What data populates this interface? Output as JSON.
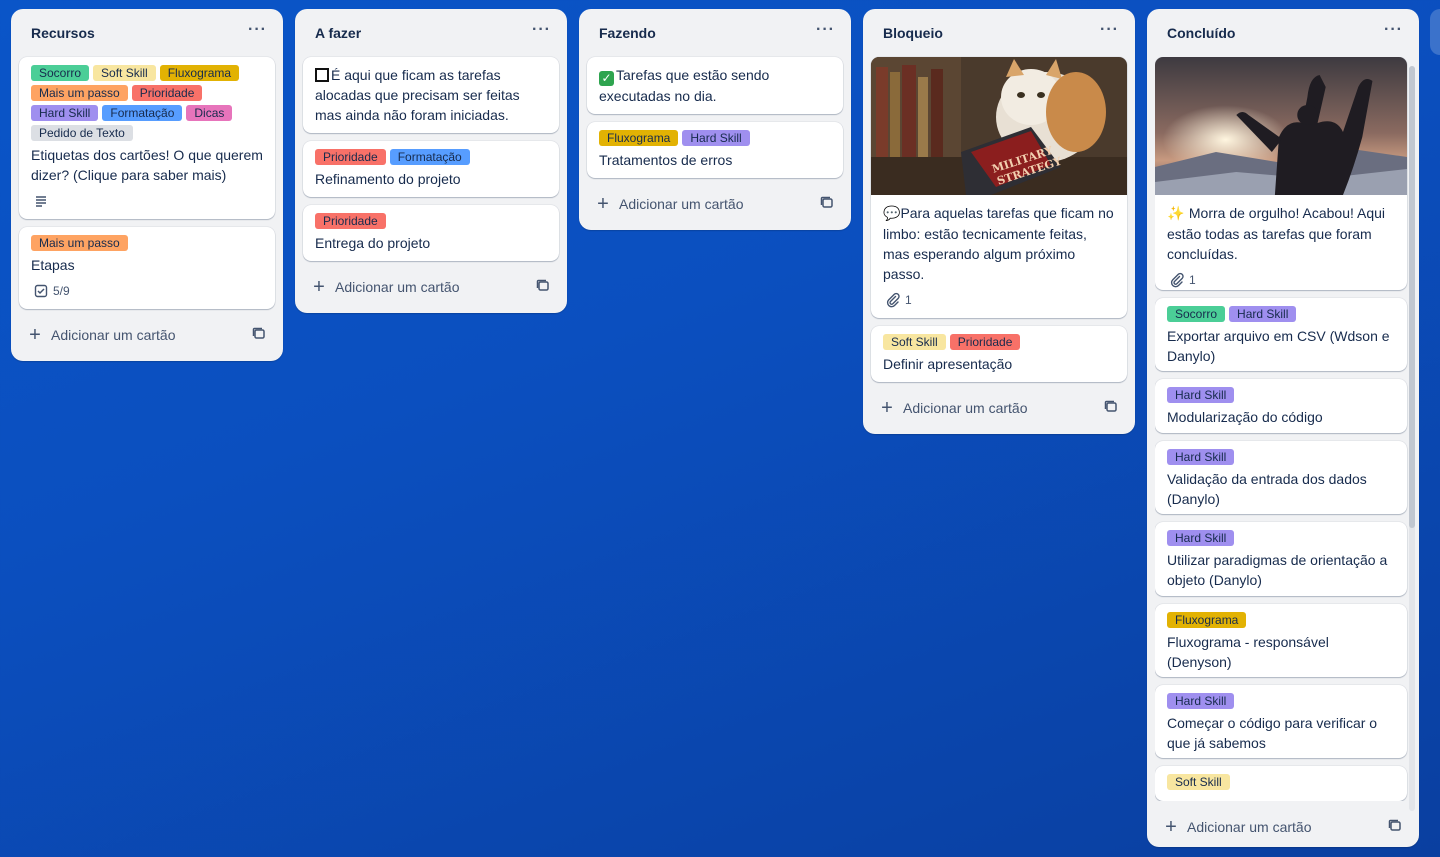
{
  "colors": {
    "green": "#4bce97",
    "yellow_light": "#f8e6a0",
    "yellow": "#e2b203",
    "orange": "#fea362",
    "red": "#f87168",
    "purple": "#9f8fef",
    "blue": "#579dff",
    "pink": "#e774bb",
    "gray": "#dcdfe4"
  },
  "add_card_label": "Adicionar um cartão",
  "lists": [
    {
      "title": "Recursos",
      "cards": [
        {
          "labels": [
            {
              "text": "Socorro",
              "color": "green"
            },
            {
              "text": "Soft Skill",
              "color": "yellow_light"
            },
            {
              "text": "Fluxograma",
              "color": "yellow"
            },
            {
              "text": "Mais um passo",
              "color": "orange"
            },
            {
              "text": "Prioridade",
              "color": "red"
            },
            {
              "text": "Hard Skill",
              "color": "purple"
            },
            {
              "text": "Formatação",
              "color": "blue"
            },
            {
              "text": "Dicas",
              "color": "pink"
            },
            {
              "text": "Pedido de Texto",
              "color": "gray"
            }
          ],
          "title": "Etiquetas dos cartões! O que querem dizer? (Clique para saber mais)",
          "badges": [
            {
              "icon": "description-icon",
              "text": ""
            }
          ]
        },
        {
          "labels": [
            {
              "text": "Mais um passo",
              "color": "orange"
            }
          ],
          "title": "Etapas",
          "badges": [
            {
              "icon": "checklist-icon",
              "text": "5/9"
            }
          ]
        }
      ]
    },
    {
      "title": "A fazer",
      "cards": [
        {
          "prefix": "square",
          "title": "É aqui que ficam as tarefas alocadas que precisam ser feitas mas ainda não foram iniciadas."
        },
        {
          "labels": [
            {
              "text": "Prioridade",
              "color": "red"
            },
            {
              "text": "Formatação",
              "color": "blue"
            }
          ],
          "title": "Refinamento do projeto"
        },
        {
          "labels": [
            {
              "text": "Prioridade",
              "color": "red"
            }
          ],
          "title": "Entrega do projeto"
        }
      ]
    },
    {
      "title": "Fazendo",
      "cards": [
        {
          "prefix": "check",
          "title": "Tarefas que estão sendo executadas no dia."
        },
        {
          "labels": [
            {
              "text": "Fluxograma",
              "color": "yellow"
            },
            {
              "text": "Hard Skill",
              "color": "purple"
            }
          ],
          "title": "Tratamentos de erros"
        }
      ]
    },
    {
      "title": "Bloqueio",
      "cards": [
        {
          "cover": "cat-reading-book",
          "prefix": "speech",
          "title": "Para aquelas tarefas que ficam no limbo: estão tecnicamente feitas, mas esperando algum próximo passo.",
          "badges": [
            {
              "icon": "attachment-icon",
              "text": "1"
            }
          ]
        },
        {
          "labels": [
            {
              "text": "Soft Skill",
              "color": "yellow_light"
            },
            {
              "text": "Prioridade",
              "color": "red"
            }
          ],
          "title": "Definir apresentação"
        }
      ]
    },
    {
      "title": "Concluído",
      "cards": [
        {
          "cover": "person-celebrating-sunset",
          "prefix": "sparkle",
          "title": "Morra de orgulho! Acabou! Aqui estão todas as tarefas que foram concluídas.",
          "badges": [
            {
              "icon": "attachment-icon",
              "text": "1"
            }
          ]
        },
        {
          "labels": [
            {
              "text": "Socorro",
              "color": "green"
            },
            {
              "text": "Hard Skill",
              "color": "purple"
            }
          ],
          "title": "Exportar arquivo em CSV (Wdson e Danylo)"
        },
        {
          "labels": [
            {
              "text": "Hard Skill",
              "color": "purple"
            }
          ],
          "title": "Modularização do código"
        },
        {
          "labels": [
            {
              "text": "Hard Skill",
              "color": "purple"
            }
          ],
          "title": "Validação da entrada dos dados (Danylo)"
        },
        {
          "labels": [
            {
              "text": "Hard Skill",
              "color": "purple"
            }
          ],
          "title": "Utilizar paradigmas de orientação a objeto (Danylo)"
        },
        {
          "labels": [
            {
              "text": "Fluxograma",
              "color": "yellow"
            }
          ],
          "title": "Fluxograma - responsável (Denyson)"
        },
        {
          "labels": [
            {
              "text": "Hard Skill",
              "color": "purple"
            }
          ],
          "title": "Começar o código para verificar o que já sabemos"
        },
        {
          "labels": [
            {
              "text": "Soft Skill",
              "color": "yellow_light"
            }
          ],
          "title": ""
        }
      ]
    }
  ]
}
